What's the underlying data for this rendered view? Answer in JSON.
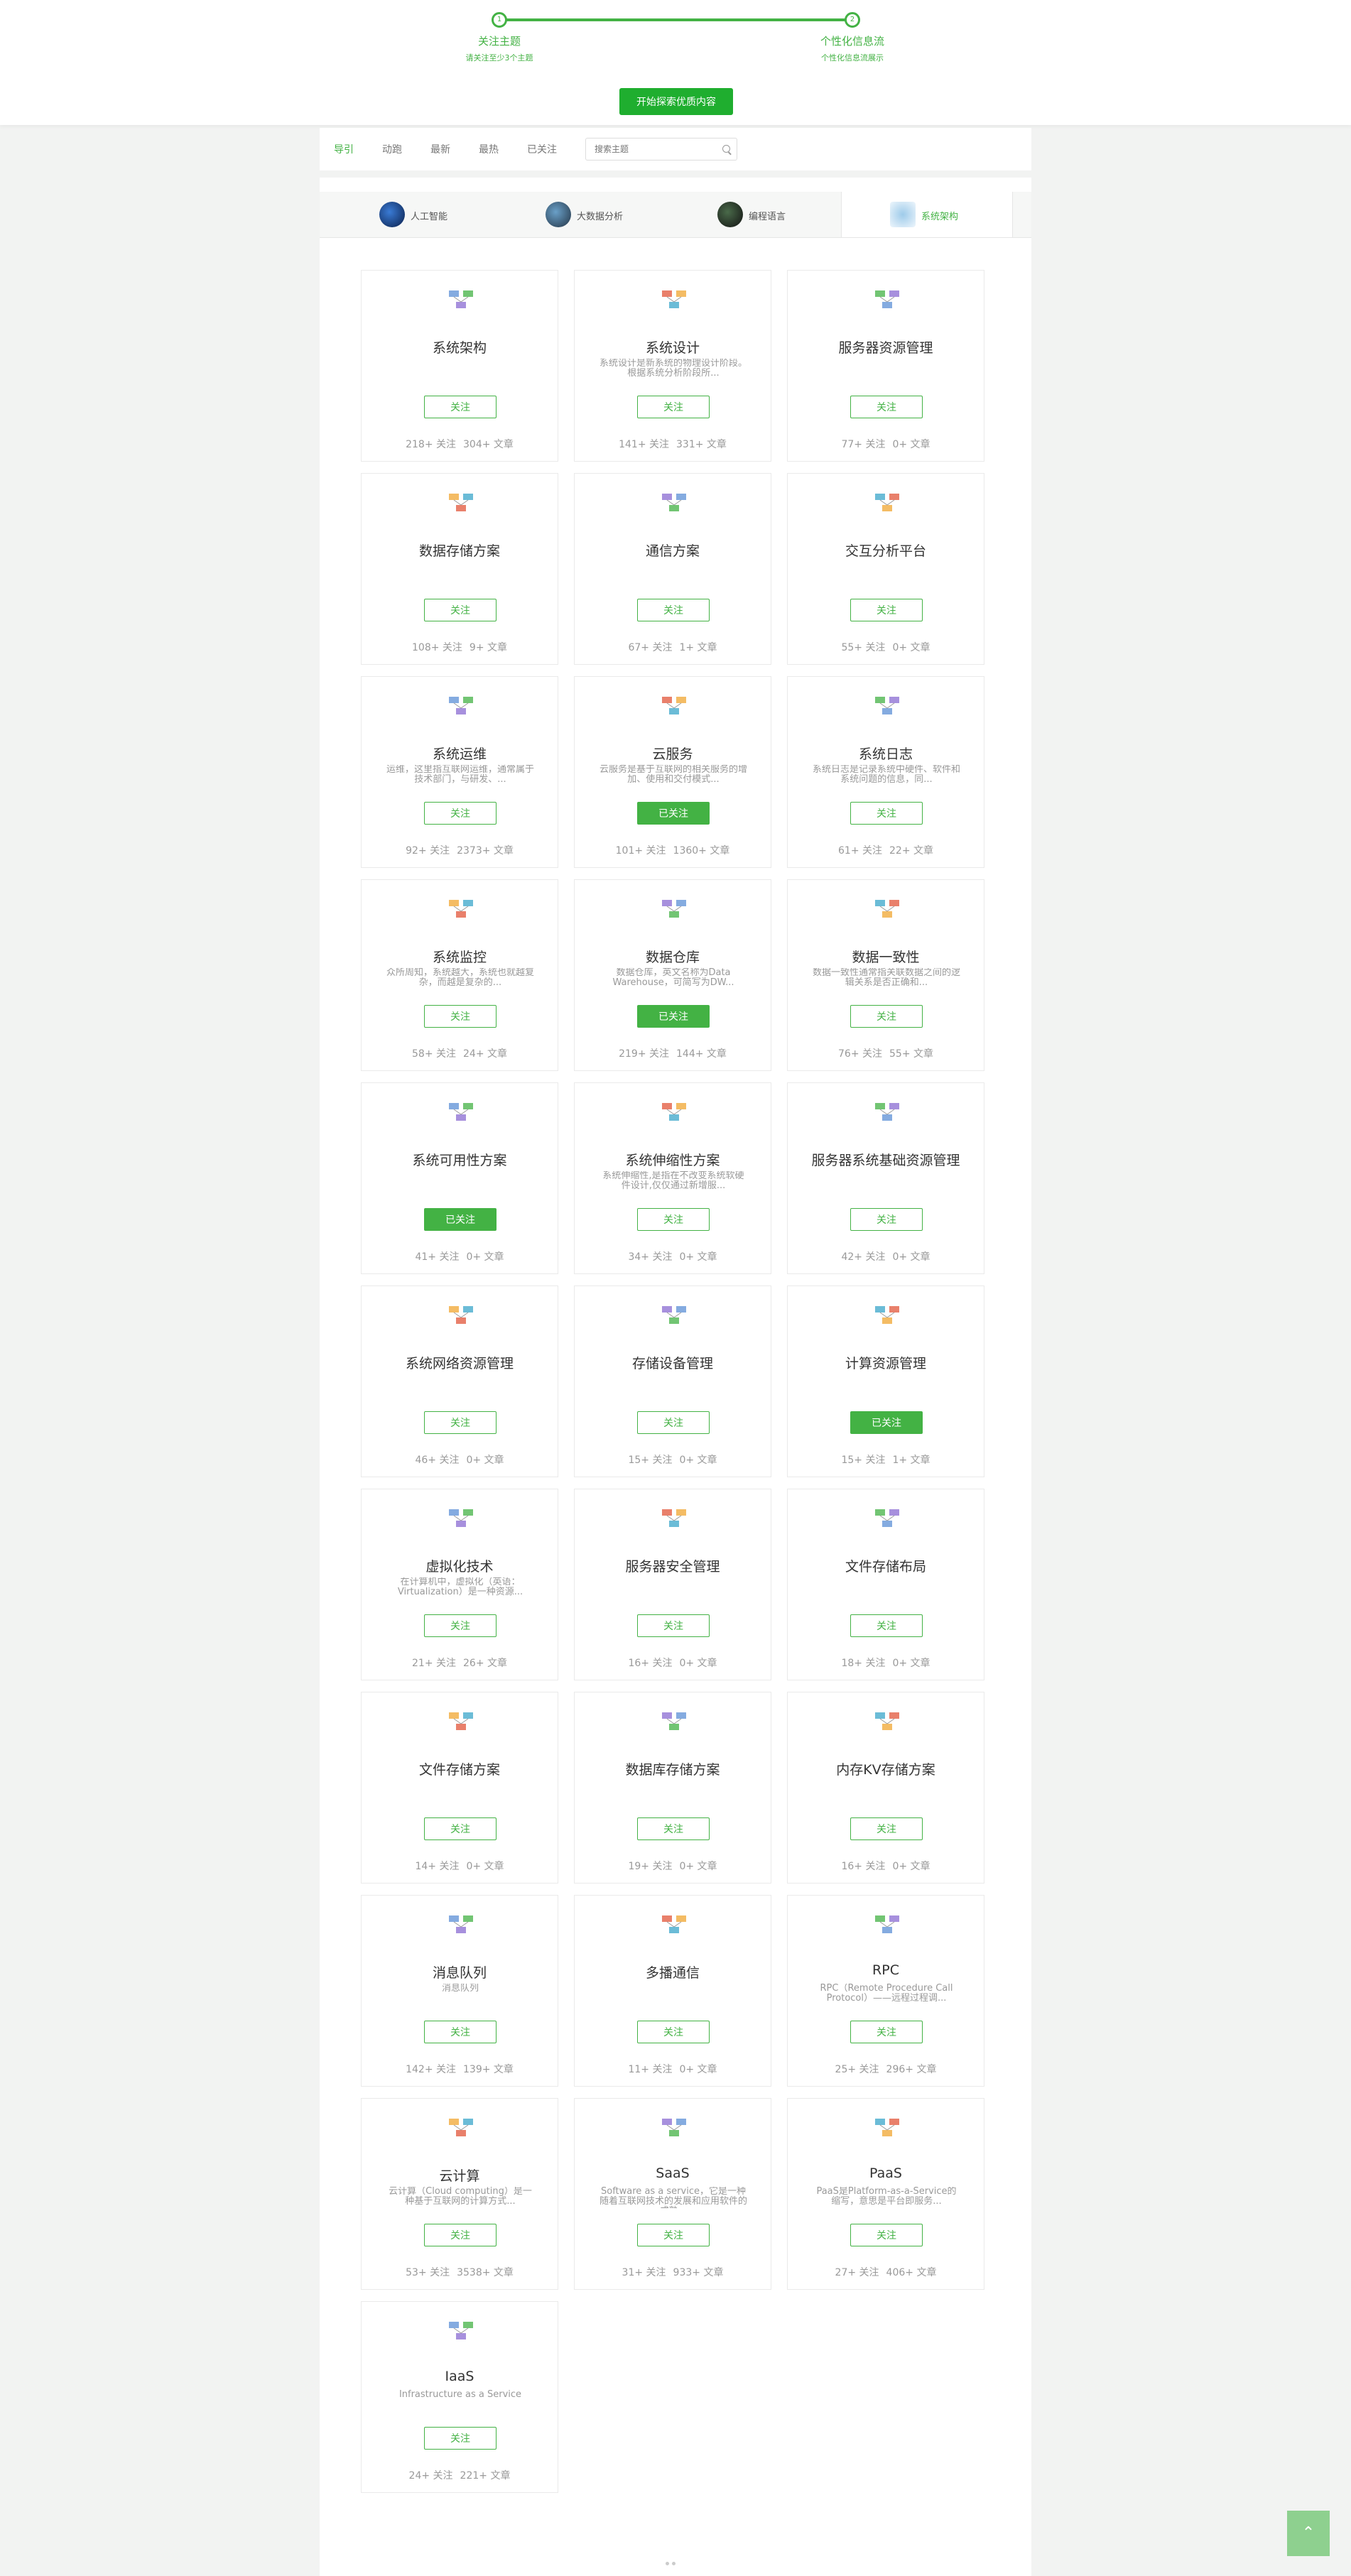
{
  "colors": {
    "accent": "#43b244",
    "button": "#1fae2f"
  },
  "steps": [
    {
      "num": "1",
      "title": "关注主题",
      "sub": "请关注至少3个主题"
    },
    {
      "num": "2",
      "title": "个性化信息流",
      "sub": "个性化信息流展示"
    }
  ],
  "explore_button": "开始探索优质内容",
  "nav": {
    "items": [
      "导引",
      "动跑",
      "最新",
      "最热",
      "已关注"
    ],
    "search_placeholder": "搜索主题"
  },
  "category_tabs": [
    {
      "label": "人工智能",
      "icon": "globe-icon",
      "active": false
    },
    {
      "label": "大数据分析",
      "icon": "data-icon",
      "active": false
    },
    {
      "label": "编程语言",
      "icon": "code-icon",
      "active": false
    },
    {
      "label": "系统架构",
      "icon": "network-icon",
      "active": true
    }
  ],
  "topics": [
    {
      "name": "系统架构",
      "desc": "",
      "button": "关注",
      "followed": false,
      "followers": "218+ 关注",
      "articles": "304+ 文章"
    },
    {
      "name": "系统设计",
      "desc": "系统设计是新系统的物理设计阶段。根据系统分析阶段所...",
      "button": "关注",
      "followed": false,
      "followers": "141+ 关注",
      "articles": "331+ 文章"
    },
    {
      "name": "服务器资源管理",
      "desc": "",
      "button": "关注",
      "followed": false,
      "followers": "77+ 关注",
      "articles": "0+ 文章"
    },
    {
      "name": "数据存储方案",
      "desc": "",
      "button": "关注",
      "followed": false,
      "followers": "108+ 关注",
      "articles": "9+ 文章"
    },
    {
      "name": "通信方案",
      "desc": "",
      "button": "关注",
      "followed": false,
      "followers": "67+ 关注",
      "articles": "1+ 文章"
    },
    {
      "name": "交互分析平台",
      "desc": "",
      "button": "关注",
      "followed": false,
      "followers": "55+ 关注",
      "articles": "0+ 文章"
    },
    {
      "name": "系统运维",
      "desc": "运维，这里指互联网运维，通常属于技术部门，与研发、...",
      "button": "关注",
      "followed": false,
      "followers": "92+ 关注",
      "articles": "2373+ 文章"
    },
    {
      "name": "云服务",
      "desc": "云服务是基于互联网的相关服务的增加、使用和交付模式...",
      "button": "已关注",
      "followed": true,
      "followers": "101+ 关注",
      "articles": "1360+ 文章"
    },
    {
      "name": "系统日志",
      "desc": "系统日志是记录系统中硬件、软件和系统问题的信息，同...",
      "button": "关注",
      "followed": false,
      "followers": "61+ 关注",
      "articles": "22+ 文章"
    },
    {
      "name": "系统监控",
      "desc": "众所周知，系统越大，系统也就越复杂，而越是复杂的...",
      "button": "关注",
      "followed": false,
      "followers": "58+ 关注",
      "articles": "24+ 文章"
    },
    {
      "name": "数据仓库",
      "desc": "数据仓库，英文名称为Data Warehouse，可简写为DW...",
      "button": "已关注",
      "followed": true,
      "followers": "219+ 关注",
      "articles": "144+ 文章"
    },
    {
      "name": "数据一致性",
      "desc": "数据一致性通常指关联数据之间的逻辑关系是否正确和...",
      "button": "关注",
      "followed": false,
      "followers": "76+ 关注",
      "articles": "55+ 文章"
    },
    {
      "name": "系统可用性方案",
      "desc": "",
      "button": "已关注",
      "followed": true,
      "followers": "41+ 关注",
      "articles": "0+ 文章"
    },
    {
      "name": "系统伸缩性方案",
      "desc": "系统伸缩性,是指在不改变系统软硬件设计,仅仅通过新增服...",
      "button": "关注",
      "followed": false,
      "followers": "34+ 关注",
      "articles": "0+ 文章"
    },
    {
      "name": "服务器系统基础资源管理",
      "desc": "",
      "button": "关注",
      "followed": false,
      "followers": "42+ 关注",
      "articles": "0+ 文章"
    },
    {
      "name": "系统网络资源管理",
      "desc": "",
      "button": "关注",
      "followed": false,
      "followers": "46+ 关注",
      "articles": "0+ 文章"
    },
    {
      "name": "存储设备管理",
      "desc": "",
      "button": "关注",
      "followed": false,
      "followers": "15+ 关注",
      "articles": "0+ 文章"
    },
    {
      "name": "计算资源管理",
      "desc": "",
      "button": "已关注",
      "followed": true,
      "followers": "15+ 关注",
      "articles": "1+ 文章"
    },
    {
      "name": "虚拟化技术",
      "desc": "在计算机中，虚拟化（英语：Virtualization）是一种资源...",
      "button": "关注",
      "followed": false,
      "followers": "21+ 关注",
      "articles": "26+ 文章"
    },
    {
      "name": "服务器安全管理",
      "desc": "",
      "button": "关注",
      "followed": false,
      "followers": "16+ 关注",
      "articles": "0+ 文章"
    },
    {
      "name": "文件存储布局",
      "desc": "",
      "button": "关注",
      "followed": false,
      "followers": "18+ 关注",
      "articles": "0+ 文章"
    },
    {
      "name": "文件存储方案",
      "desc": "",
      "button": "关注",
      "followed": false,
      "followers": "14+ 关注",
      "articles": "0+ 文章"
    },
    {
      "name": "数据库存储方案",
      "desc": "",
      "button": "关注",
      "followed": false,
      "followers": "19+ 关注",
      "articles": "0+ 文章"
    },
    {
      "name": "内存KV存储方案",
      "desc": "",
      "button": "关注",
      "followed": false,
      "followers": "16+ 关注",
      "articles": "0+ 文章"
    },
    {
      "name": "消息队列",
      "desc": "消息队列",
      "button": "关注",
      "followed": false,
      "followers": "142+ 关注",
      "articles": "139+ 文章"
    },
    {
      "name": "多播通信",
      "desc": "",
      "button": "关注",
      "followed": false,
      "followers": "11+ 关注",
      "articles": "0+ 文章"
    },
    {
      "name": "RPC",
      "desc": "RPC（Remote Procedure Call Protocol）——远程过程调...",
      "button": "关注",
      "followed": false,
      "followers": "25+ 关注",
      "articles": "296+ 文章"
    },
    {
      "name": "云计算",
      "desc": "云计算（Cloud computing）是一种基于互联网的计算方式...",
      "button": "关注",
      "followed": false,
      "followers": "53+ 关注",
      "articles": "3538+ 文章"
    },
    {
      "name": "SaaS",
      "desc": "Software as a service，它是一种随着互联网技术的发展和应用软件的成熟...",
      "button": "关注",
      "followed": false,
      "followers": "31+ 关注",
      "articles": "933+ 文章"
    },
    {
      "name": "PaaS",
      "desc": "PaaS是Platform-as-a-Service的缩写，意思是平台即服务...",
      "button": "关注",
      "followed": false,
      "followers": "27+ 关注",
      "articles": "406+ 文章"
    },
    {
      "name": "IaaS",
      "desc": "Infrastructure as a Service",
      "button": "关注",
      "followed": false,
      "followers": "24+ 关注",
      "articles": "221+ 文章"
    }
  ],
  "to_top_icon": "chevron-up-icon"
}
